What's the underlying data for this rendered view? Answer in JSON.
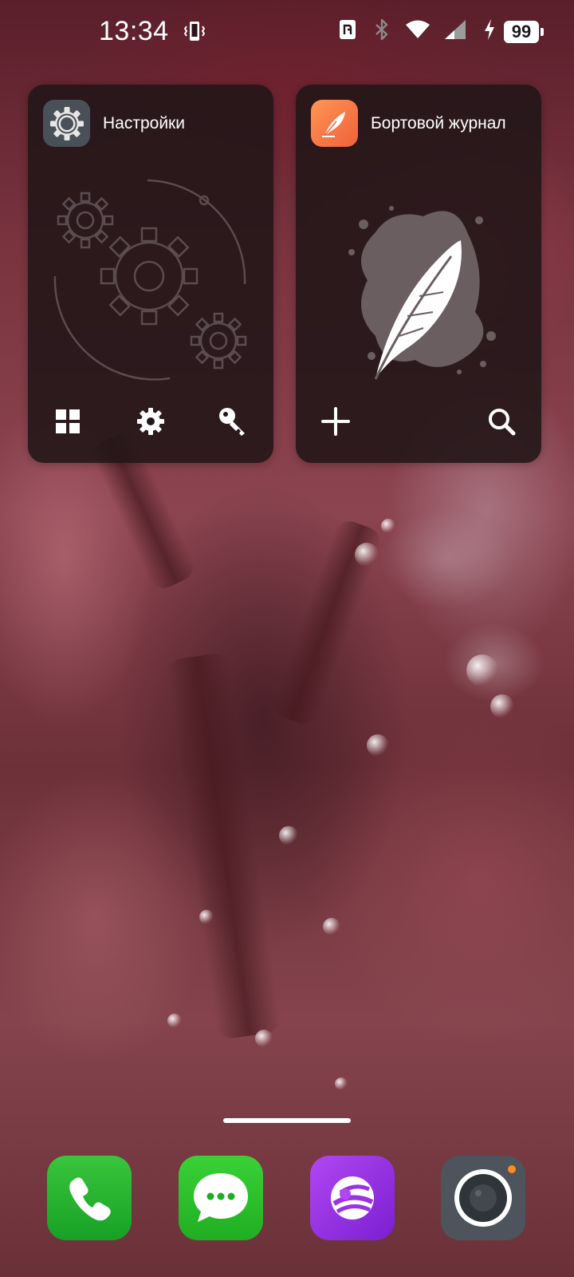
{
  "status_bar": {
    "time": "13:34",
    "battery_level": "99",
    "icons": [
      "vibrate-icon",
      "nfc-icon",
      "bluetooth-icon",
      "wifi-icon",
      "cellular-signal-icon",
      "charging-icon",
      "battery-icon"
    ]
  },
  "widgets": {
    "settings": {
      "title": "Настройки",
      "icon": "gear-icon",
      "actions": [
        "apps-grid-icon",
        "gear-icon",
        "key-icon"
      ]
    },
    "journal": {
      "title": "Бортовой журнал",
      "icon": "feather-icon",
      "actions": [
        "plus-icon",
        "search-icon"
      ]
    }
  },
  "dock": [
    "phone-icon",
    "messages-icon",
    "browser-icon",
    "camera-icon"
  ],
  "colors": {
    "widget_bg": "#221618",
    "journal_accent": "#f0613a",
    "settings_icon_bg": "#4a5058",
    "phone_green": "#16a124",
    "browser_purple": "#7a1fd1",
    "camera_dot": "#ff8a1f"
  }
}
